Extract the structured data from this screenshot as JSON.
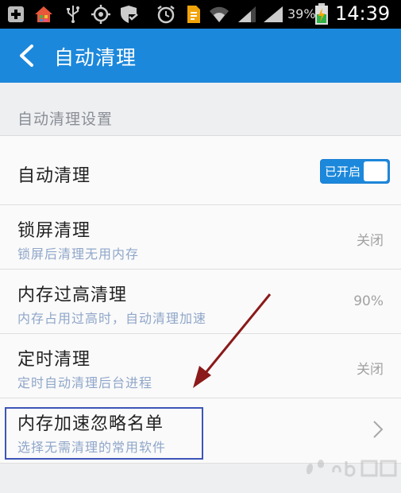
{
  "status_bar": {
    "battery_percent": "39%",
    "time": "14:39",
    "icons": [
      "add-notification-icon",
      "home-app-icon",
      "usb-icon",
      "gps-icon",
      "shield-check-icon",
      "alarm-icon",
      "file-icon",
      "wifi-icon",
      "signal-icon",
      "battery-icon"
    ]
  },
  "header": {
    "title": "自动清理"
  },
  "section": {
    "title": "自动清理设置"
  },
  "settings": [
    {
      "title": "自动清理",
      "toggle_label": "已开启",
      "toggle_on": true
    },
    {
      "title": "锁屏清理",
      "subtitle": "锁屏后清理无用内存",
      "value": "关闭"
    },
    {
      "title": "内存过高清理",
      "subtitle": "内存占用过高时，自动清理加速",
      "value": "90%"
    },
    {
      "title": "定时清理",
      "subtitle": "定时自动清理后台进程",
      "value": "关闭"
    },
    {
      "title": "内存加速忽略名单",
      "subtitle": "选择无需清理的常用软件"
    }
  ],
  "colors": {
    "accent": "#1c88db",
    "annotation_arrow": "#8b1a1a",
    "highlight_box": "#3d55b7"
  }
}
